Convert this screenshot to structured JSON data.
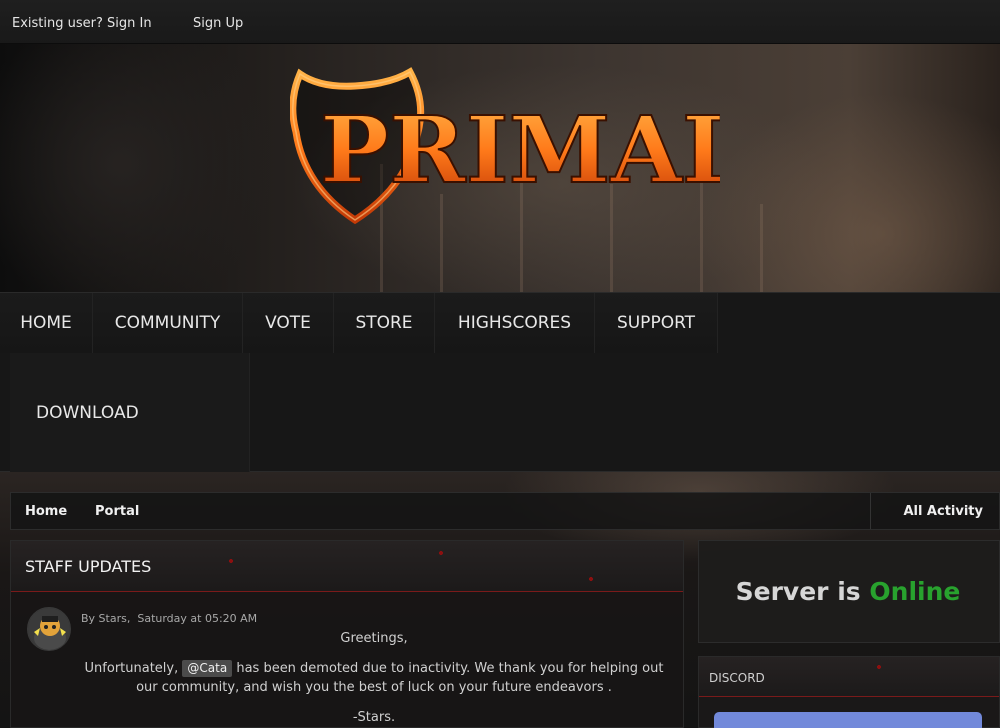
{
  "topbar": {
    "signin_label": "Existing user? Sign In",
    "signup_label": "Sign Up"
  },
  "banner": {
    "logo_text": "PRIMAL"
  },
  "nav": {
    "items": [
      {
        "label": "HOME"
      },
      {
        "label": "COMMUNITY"
      },
      {
        "label": "VOTE"
      },
      {
        "label": "STORE"
      },
      {
        "label": "HIGHSCORES"
      },
      {
        "label": "SUPPORT"
      },
      {
        "label": "DOWNLOAD"
      }
    ]
  },
  "breadcrumb": {
    "items": [
      "Home",
      "Portal"
    ],
    "activity_label": "All Activity"
  },
  "staff_updates": {
    "title": "STAFF UPDATES",
    "post": {
      "by_label": "By Stars,",
      "date": "Saturday at 05:20 AM",
      "greeting": "Greetings,",
      "before_mention": "Unfortunately,",
      "mention": "@Cata",
      "after_mention": "has been demoted due to inactivity. We thank you for helping out our community, and wish you the best of luck on your future endeavors .",
      "signoff": "-Stars."
    }
  },
  "server": {
    "status_prefix": "Server is",
    "status_value": "Online",
    "status_color": "#28a22e"
  },
  "discord": {
    "title": "DISCORD",
    "widget_color": "#7289da"
  },
  "colors": {
    "accent_red": "#7a1a1a",
    "logo_orange": "#ff7a1a"
  }
}
